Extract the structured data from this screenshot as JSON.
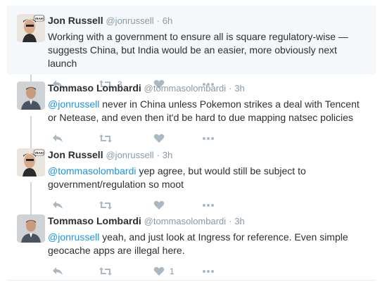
{
  "tweets": [
    {
      "fullname": "Jon Russell",
      "username": "@jonrussell",
      "dot": "·",
      "time": "6h",
      "text_mention": "",
      "text": "Working with a government to ensure all is square regulatory-wise — suggests China, but India would be an easier, more obviously next launch",
      "retweet_count": "3",
      "like_count": "",
      "avatar_badge": "YEAH!"
    },
    {
      "fullname": "Tommaso Lombardi",
      "username": "@tommasolombardi",
      "dot": "·",
      "time": "3h",
      "text_mention": "@jonrussell",
      "text": " never in China unless Pokemon strikes a deal with Tencent or Netease, and even then it'd be hard to due mapping natsec policies",
      "retweet_count": "",
      "like_count": "",
      "avatar_badge": ""
    },
    {
      "fullname": "Jon Russell",
      "username": "@jonrussell",
      "dot": "·",
      "time": "3h",
      "text_mention": "@tommasolombardi",
      "text": " yep agree, but would still be subject to government/regulation so moot",
      "retweet_count": "",
      "like_count": "",
      "avatar_badge": "YEAH!"
    },
    {
      "fullname": "Tommaso Lombardi",
      "username": "@tommasolombardi",
      "dot": "·",
      "time": "3h",
      "text_mention": "@jonrussell",
      "text": " yeah, and just look at Ingress for reference. Even simple geocache apps are illegal here.",
      "retweet_count": "",
      "like_count": "1",
      "avatar_badge": ""
    }
  ],
  "icons": {
    "reply": "reply-icon",
    "retweet": "retweet-icon",
    "like": "heart-icon",
    "more": "more-icon"
  },
  "colors": {
    "mention": "#1b95e0",
    "meta": "#8899a6",
    "icon": "#aab8c2",
    "highlight_bg": "#f5f8fa",
    "connector": "#ccd6dd"
  }
}
